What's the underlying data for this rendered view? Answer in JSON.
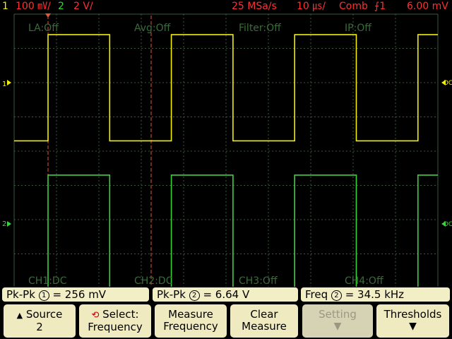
{
  "status": {
    "ch1_num": "1",
    "ch1_scale": "100 ㎷/",
    "ch2_num": "2",
    "ch2_scale": "2 V/",
    "sample_rate": "25 MSa/s",
    "timebase": "10 ㎲/",
    "trigger_mode": "Comb",
    "trigger_src": "⨍1",
    "trigger_level": "6.00 mV"
  },
  "overlay": {
    "la": "LA:Off",
    "avg": "Avg:Off",
    "filter": "Filter:Off",
    "ip": "IP:Off",
    "ch1_cpl": "CH1:DC",
    "ch2_cpl": "CH2:DC",
    "ch3_cpl": "CH3:Off",
    "ch4_cpl": "CH4:Off",
    "marker_1": "1",
    "marker_2": "2",
    "marker_dc_a": "DC",
    "marker_dc_b": "DC"
  },
  "measurements": [
    {
      "label": "Pk-Pk",
      "channel": "1",
      "value": "= 256 mV"
    },
    {
      "label": "Pk-Pk",
      "channel": "2",
      "value": "=  6.64  V"
    },
    {
      "label": "Freq",
      "channel": "2",
      "value": "=  34.5 kHz"
    }
  ],
  "softkeys": {
    "source": {
      "line1": "Source",
      "line2": "2"
    },
    "select": {
      "line1": "Select:",
      "line2": "Frequency"
    },
    "measure": {
      "line1": "Measure",
      "line2": "Frequency"
    },
    "clear": {
      "line1": "Clear",
      "line2": "Measure"
    },
    "setting": {
      "line1": "Setting"
    },
    "thresholds": {
      "line1": "Thresholds"
    }
  },
  "colors": {
    "ch1": "#f2f000",
    "ch2": "#3cd23c",
    "status_red": "#ff3030",
    "grid": "#3a5a3a",
    "cursor": "#e05a3a"
  },
  "waveforms": {
    "ch1_low": -1.7,
    "ch1_high": 1.4,
    "ch2_low": -2.1,
    "ch2_high": 1.3,
    "period_divs": 2.91,
    "duty": 0.5
  }
}
